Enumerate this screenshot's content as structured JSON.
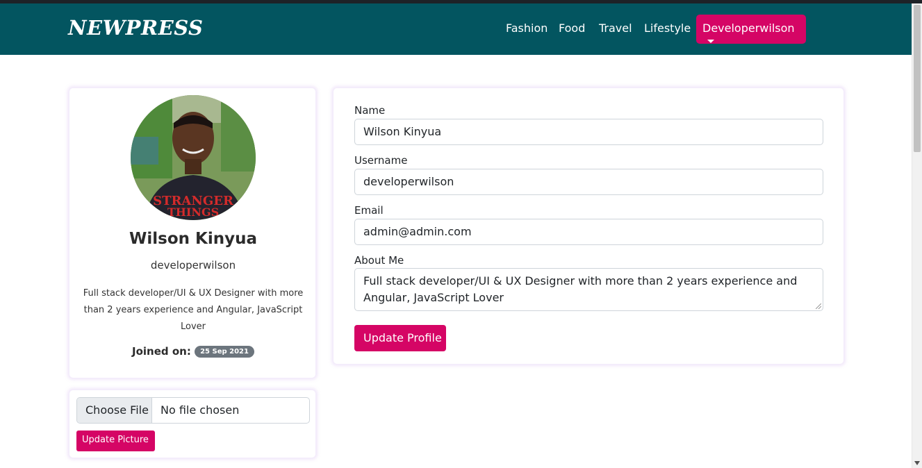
{
  "navbar": {
    "brand": "NEWPRESS",
    "links": [
      "Fashion",
      "Food",
      "Travel",
      "Lifestyle"
    ],
    "user_menu": "Developerwilson"
  },
  "profile": {
    "name": "Wilson Kinyua",
    "username": "developerwilson",
    "about": "Full stack developer/UI & UX Designer with more than 2 years experience and Angular, JavaScript Lover",
    "joined_label": "Joined on:",
    "joined_date": "25 Sep 2021"
  },
  "upload": {
    "choose_file_label": "Choose File",
    "file_status": "No file chosen",
    "update_picture_label": "Update Picture"
  },
  "form": {
    "name_label": "Name",
    "name_value": "Wilson Kinyua",
    "username_label": "Username",
    "username_value": "developerwilson",
    "email_label": "Email",
    "email_value": "admin@admin.com",
    "about_label": "About Me",
    "about_value": "Full stack developer/UI & UX Designer with more than 2 years experience and Angular, JavaScript Lover",
    "submit_label": "Update Profile"
  },
  "colors": {
    "navbar": "#035560",
    "accent": "#d50565",
    "badge": "#6c757d"
  }
}
